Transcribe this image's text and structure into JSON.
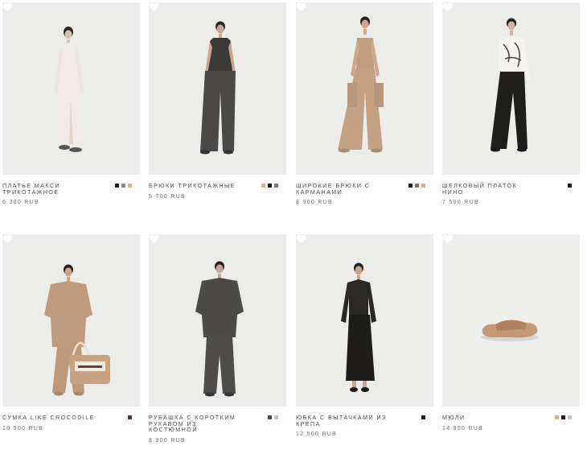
{
  "products": [
    {
      "name": "ПЛАТЬЕ МАКСИ ТРИКОТАЖНОЕ",
      "price": "6 300 RUB",
      "swatches": [
        "#1f1f1f",
        "#8b8682",
        "#c9b59c"
      ]
    },
    {
      "name": "БРЮКИ ТРИКОТАЖНЫЕ",
      "price": "5 700 RUB",
      "swatches": [
        "#c9b59c",
        "#1f1f1f",
        "#7a7774"
      ]
    },
    {
      "name": "ШИРОКИЕ БРЮКИ С КАРМАНАМИ",
      "price": "8 900 RUB",
      "swatches": [
        "#1f1f1f",
        "#7a7774",
        "#c9b59c"
      ]
    },
    {
      "name": "ШЕЛКОВЫЙ ПЛАТОК НИНО",
      "price": "7 500 RUB",
      "swatches": [
        "#1f1f1f"
      ]
    },
    {
      "name": "СУМКА LIKE CROCODILE",
      "price": "10 900 RUB",
      "swatches": [
        "#4a3b30"
      ]
    },
    {
      "name": "РУБАШКА С КОРОТКИМ РУКАВОМ ИЗ КОСТЮМНОЙ",
      "price": "8 900 RUB",
      "swatches": [
        "#4d4b4a",
        "#c4c2c0"
      ]
    },
    {
      "name": "ЮБКА С ВЫТАЧКАМИ ИЗ КРЕПА",
      "price": "12 500 RUB",
      "swatches": [
        "#1f1f1f"
      ]
    },
    {
      "name": "МЮЛИ",
      "price": "14 900 RUB",
      "swatches": [
        "#c9b59c",
        "#1f1f1f",
        "#c4c2c0"
      ]
    }
  ]
}
